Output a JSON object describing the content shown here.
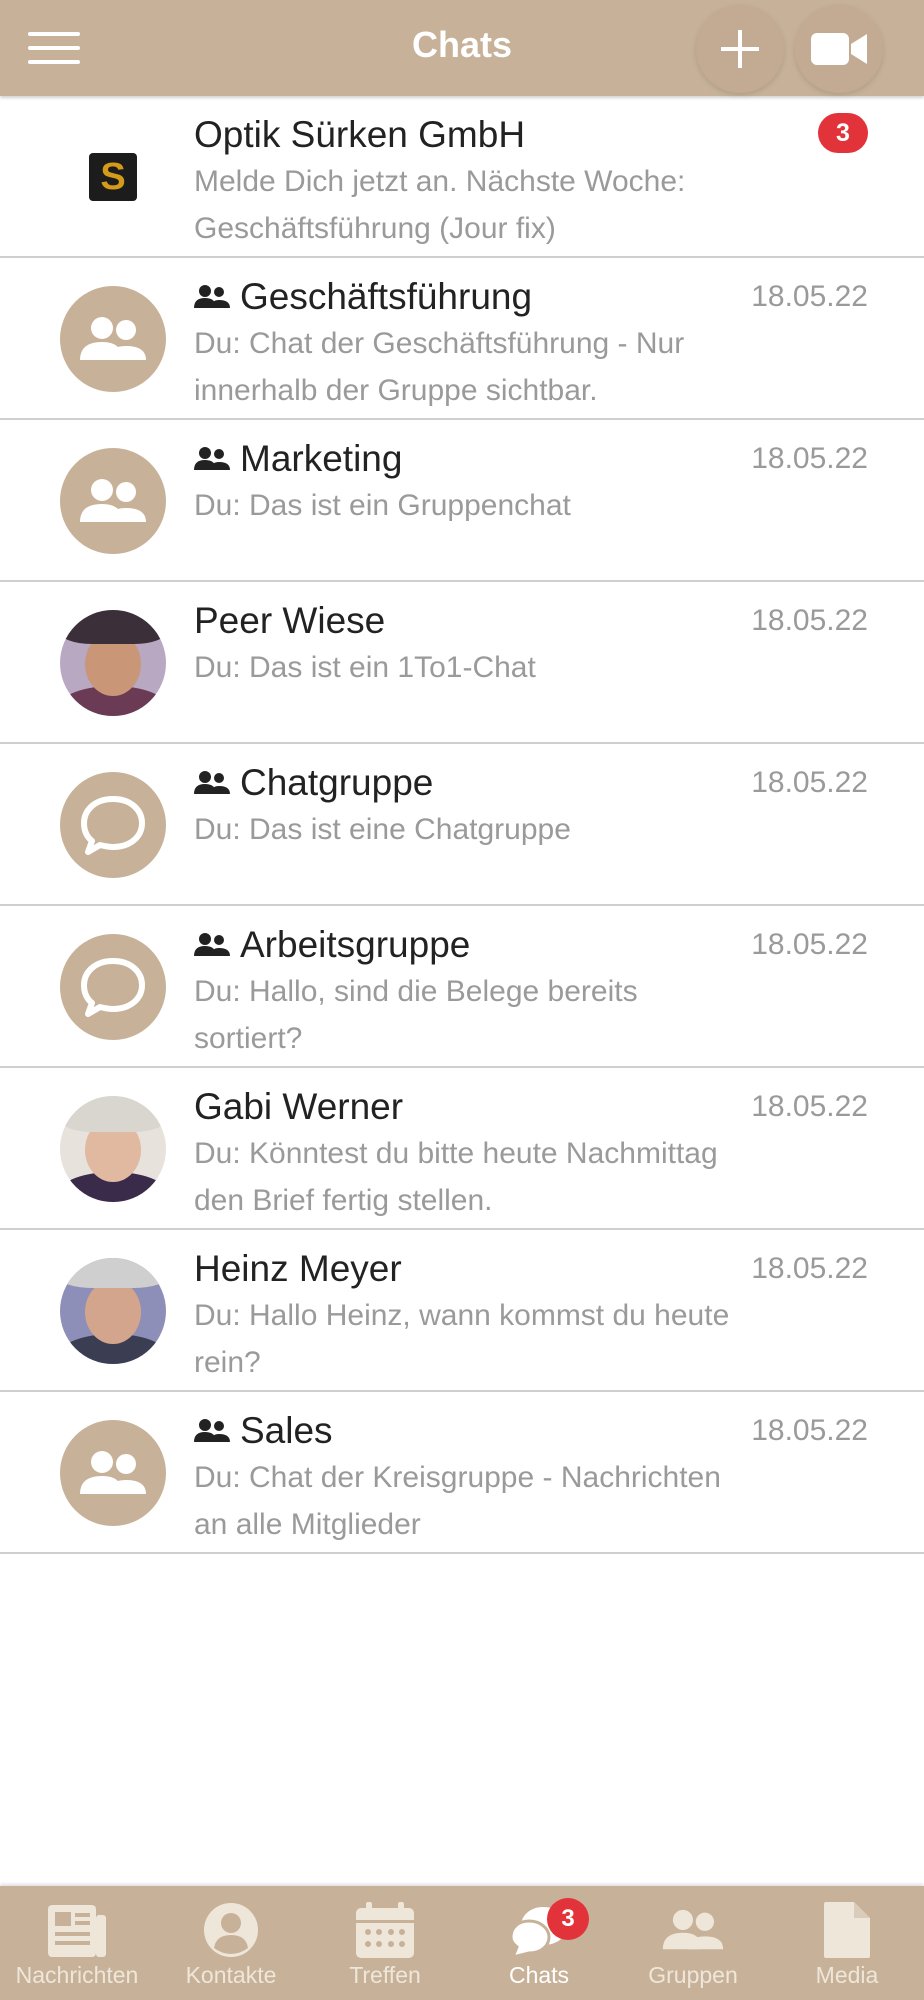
{
  "header": {
    "title": "Chats",
    "menu_icon": "hamburger-menu-icon",
    "add_icon": "plus-icon",
    "video_icon": "video-camera-icon"
  },
  "colors": {
    "accent": "#c7b299",
    "badge": "#e2333a",
    "muted_text": "#9a9a9a"
  },
  "chats": [
    {
      "name": "Optik Sürken GmbH",
      "message": "Melde Dich jetzt an. Nächste Woche: Geschäftsführung (Jour fix)",
      "badge": "3",
      "avatar": "company-logo",
      "logo_letter": "S",
      "is_group": false
    },
    {
      "name": "Geschäftsführung",
      "message": "Du: Chat der Geschäftsführung - Nur innerhalb der Gruppe sichtbar.",
      "date": "18.05.22",
      "avatar": "group-icon",
      "is_group": true
    },
    {
      "name": "Marketing",
      "message": "Du: Das ist ein Gruppenchat",
      "date": "18.05.22",
      "avatar": "group-icon",
      "is_group": true
    },
    {
      "name": "Peer Wiese",
      "message": "Du: Das ist ein 1To1-Chat",
      "date": "18.05.22",
      "avatar": "photo",
      "is_group": false
    },
    {
      "name": "Chatgruppe",
      "message": "Du: Das ist eine Chatgruppe",
      "date": "18.05.22",
      "avatar": "chat-bubble-icon",
      "is_group": true
    },
    {
      "name": "Arbeitsgruppe",
      "message": "Du: Hallo, sind die Belege bereits sortiert?",
      "date": "18.05.22",
      "avatar": "chat-bubble-icon",
      "is_group": true
    },
    {
      "name": "Gabi Werner",
      "message": "Du: Könntest du bitte heute Nachmittag den Brief fertig stellen.",
      "date": "18.05.22",
      "avatar": "photo",
      "is_group": false
    },
    {
      "name": "Heinz Meyer",
      "message": "Du: Hallo Heinz, wann kommst du heute rein?",
      "date": "18.05.22",
      "avatar": "photo",
      "is_group": false
    },
    {
      "name": "Sales",
      "message": "Du: Chat der Kreisgruppe - Nachrichten an alle Mitglieder",
      "date": "18.05.22",
      "avatar": "group-icon",
      "is_group": true
    }
  ],
  "nav": [
    {
      "label": "Nachrichten",
      "icon": "newspaper-icon"
    },
    {
      "label": "Kontakte",
      "icon": "contact-icon"
    },
    {
      "label": "Treffen",
      "icon": "calendar-icon"
    },
    {
      "label": "Chats",
      "icon": "chat-bubbles-icon",
      "badge": "3",
      "active": true
    },
    {
      "label": "Gruppen",
      "icon": "group-icon"
    },
    {
      "label": "Media",
      "icon": "document-icon"
    }
  ]
}
